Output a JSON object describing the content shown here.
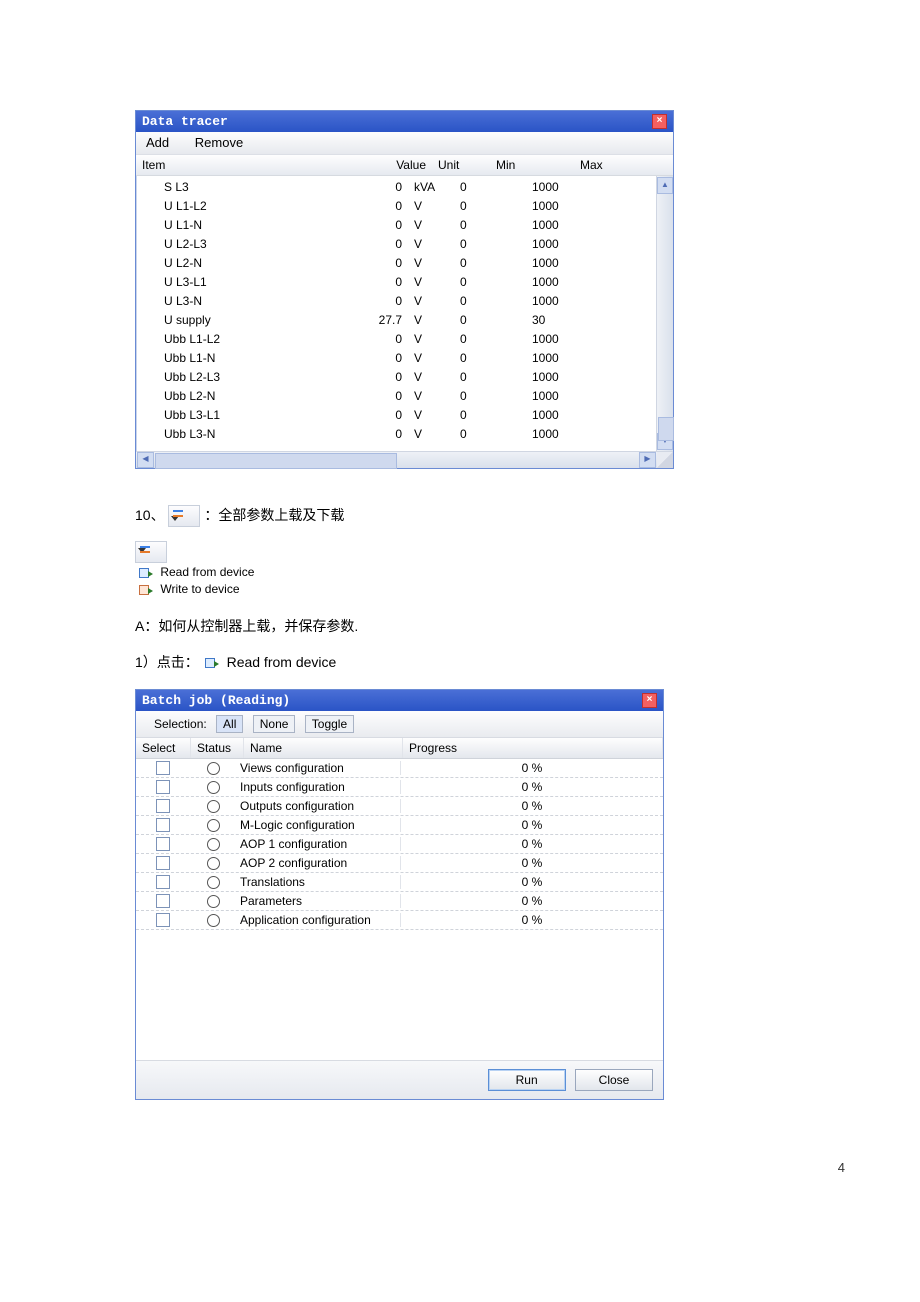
{
  "dataTracer": {
    "title": "Data tracer",
    "toolbar": {
      "add": "Add",
      "remove": "Remove"
    },
    "headers": {
      "item": "Item",
      "value": "Value",
      "unit": "Unit",
      "min": "Min",
      "max": "Max"
    },
    "rows": [
      {
        "item": "S L3",
        "value": "0",
        "unit": "kVA",
        "min": "0",
        "max": "1000"
      },
      {
        "item": "U L1-L2",
        "value": "0",
        "unit": "V",
        "min": "0",
        "max": "1000"
      },
      {
        "item": "U L1-N",
        "value": "0",
        "unit": "V",
        "min": "0",
        "max": "1000"
      },
      {
        "item": "U L2-L3",
        "value": "0",
        "unit": "V",
        "min": "0",
        "max": "1000"
      },
      {
        "item": "U L2-N",
        "value": "0",
        "unit": "V",
        "min": "0",
        "max": "1000"
      },
      {
        "item": "U L3-L1",
        "value": "0",
        "unit": "V",
        "min": "0",
        "max": "1000"
      },
      {
        "item": "U L3-N",
        "value": "0",
        "unit": "V",
        "min": "0",
        "max": "1000"
      },
      {
        "item": "U supply",
        "value": "27.7",
        "unit": "V",
        "min": "0",
        "max": "30"
      },
      {
        "item": "Ubb L1-L2",
        "value": "0",
        "unit": "V",
        "min": "0",
        "max": "1000"
      },
      {
        "item": "Ubb L1-N",
        "value": "0",
        "unit": "V",
        "min": "0",
        "max": "1000"
      },
      {
        "item": "Ubb L2-L3",
        "value": "0",
        "unit": "V",
        "min": "0",
        "max": "1000"
      },
      {
        "item": "Ubb L2-N",
        "value": "0",
        "unit": "V",
        "min": "0",
        "max": "1000"
      },
      {
        "item": "Ubb L3-L1",
        "value": "0",
        "unit": "V",
        "min": "0",
        "max": "1000"
      },
      {
        "item": "Ubb L3-N",
        "value": "0",
        "unit": "V",
        "min": "0",
        "max": "1000"
      }
    ]
  },
  "text": {
    "line10_prefix": "10、",
    "line10_suffix": "：全部参数上载及下载",
    "readFromDevice": "Read from device",
    "writeToDevice": "Write to device",
    "lineA": "A：如何从控制器上载，并保存参数.",
    "line1_prefix": "1）点击：",
    "line1_suffix": "Read from device"
  },
  "batch": {
    "title": "Batch job (Reading)",
    "selectionLabel": "Selection:",
    "btnAll": "All",
    "btnNone": "None",
    "btnToggle": "Toggle",
    "headers": {
      "select": "Select",
      "status": "Status",
      "name": "Name",
      "progress": "Progress"
    },
    "rows": [
      {
        "name": "Views configuration",
        "progress": "0 %"
      },
      {
        "name": "Inputs configuration",
        "progress": "0 %"
      },
      {
        "name": "Outputs configuration",
        "progress": "0 %"
      },
      {
        "name": "M-Logic configuration",
        "progress": "0 %"
      },
      {
        "name": "AOP 1 configuration",
        "progress": "0 %"
      },
      {
        "name": "AOP 2 configuration",
        "progress": "0 %"
      },
      {
        "name": "Translations",
        "progress": "0 %"
      },
      {
        "name": "Parameters",
        "progress": "0 %"
      },
      {
        "name": "Application configuration",
        "progress": "0 %"
      }
    ],
    "run": "Run",
    "close": "Close"
  },
  "pageNumber": "4"
}
